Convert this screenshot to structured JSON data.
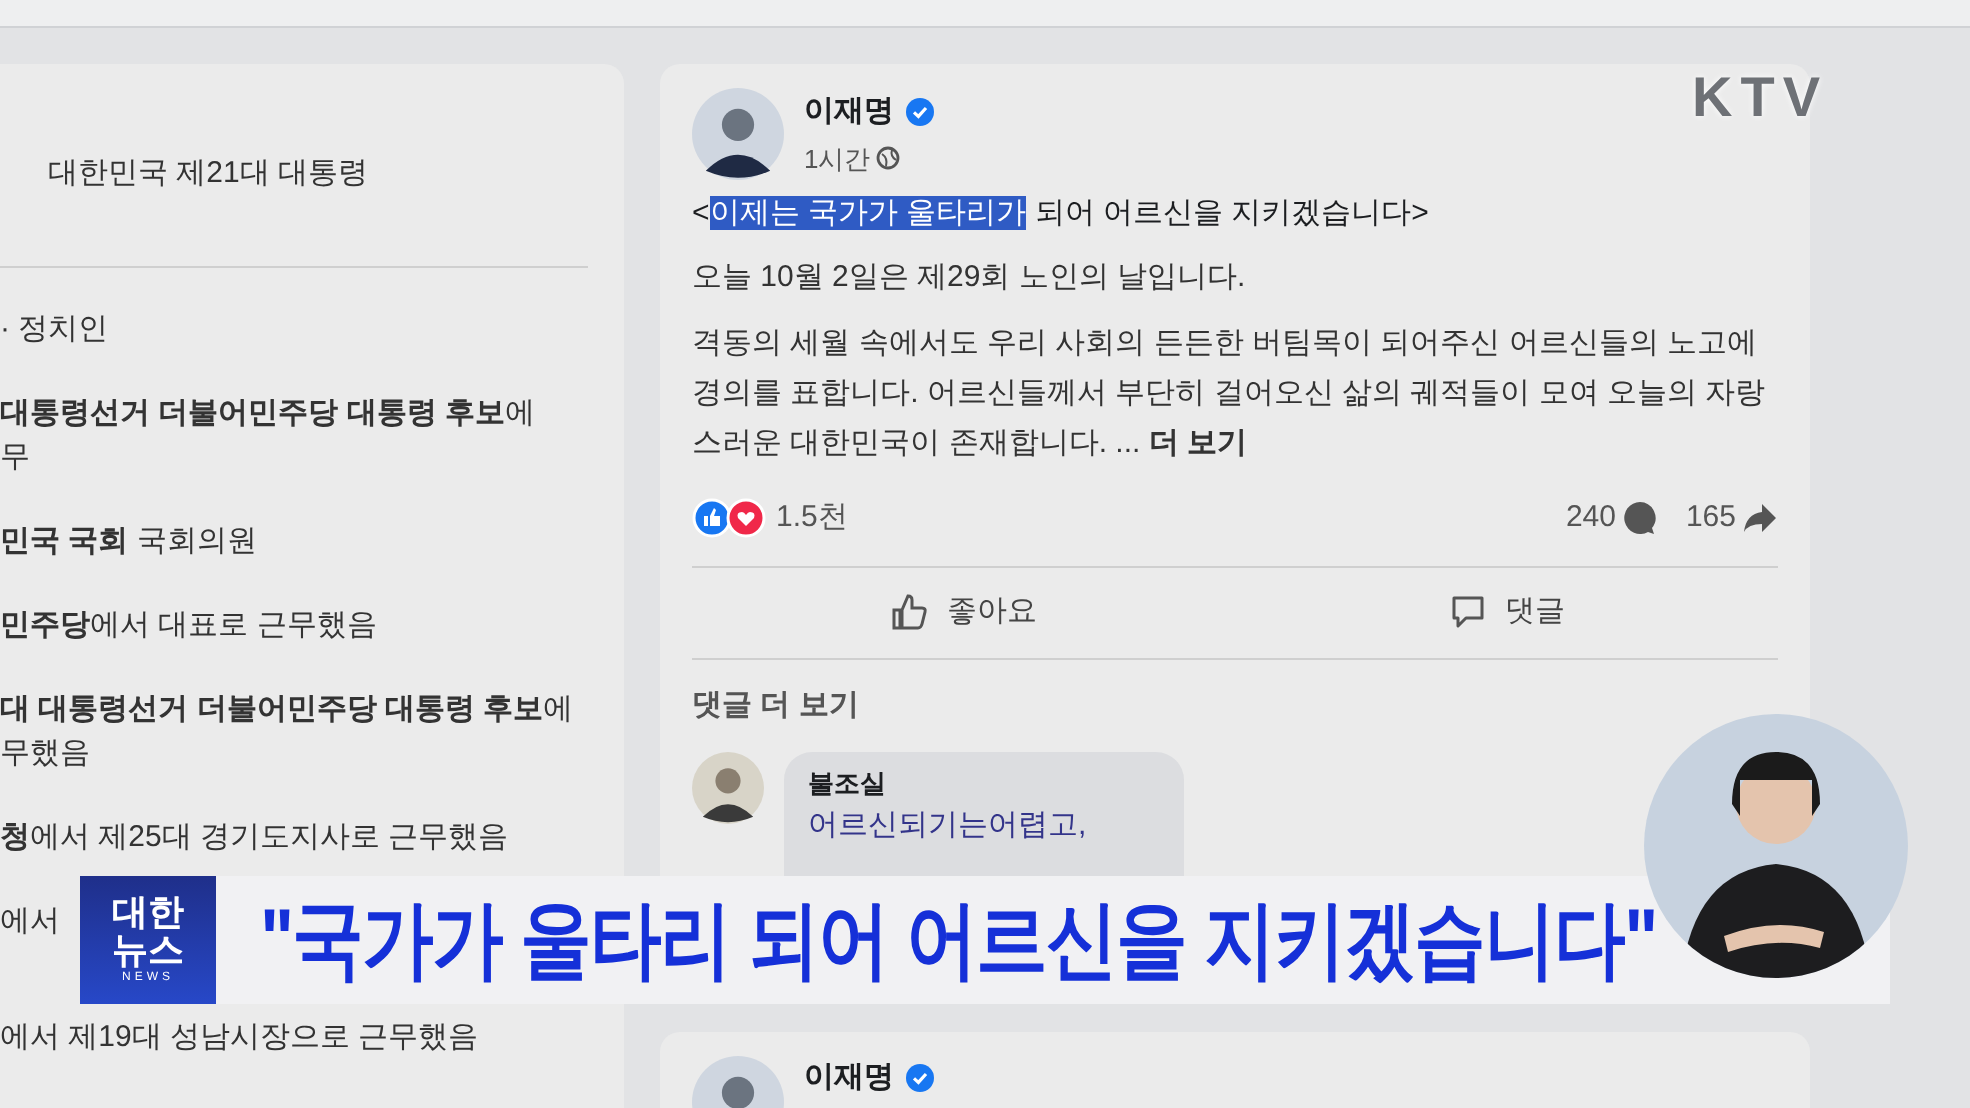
{
  "header": {
    "channel_logo": "KTV"
  },
  "sidebar": {
    "title": "대한민국 제21대 대통령",
    "items": [
      {
        "text": "· 정치인"
      },
      {
        "text": "**대통령선거 더불어민주당 대통령 후보**에",
        "continuation": "무"
      },
      {
        "text": "**민국 국회** 국회의원"
      },
      {
        "text": "**민주당**에서 대표로 근무했음"
      },
      {
        "text": "**대 대통령선거 더불어민주당 대통령 후보**에",
        "continuation": "무했음"
      },
      {
        "text": "**청**에서 제25대 경기도지사로 근무했음"
      },
      {
        "text": "에서"
      },
      {
        "text": "에서 제19대 성남시장으로 근무했음"
      }
    ]
  },
  "post": {
    "author": "이재명",
    "verified": true,
    "time": "1시간",
    "headline": {
      "prefix": "<",
      "highlighted": "이제는 국가가 울타리가",
      "rest": " 되어 어르신을 지키겠습니다>"
    },
    "paragraphs": [
      "오늘 10월 2일은 제29회 노인의 날입니다.",
      "격동의 세월 속에서도 우리 사회의 든든한 버팀목이 되어주신 어르신들의 노고에 경의를 표합니다. 어르신들께서 부단히 걸어오신 삶의 궤적들이 모여 오늘의 자랑스러운 대한민국이 존재합니다. ..."
    ],
    "more": "더 보기",
    "reactions": "1.5천",
    "comments_count": "240",
    "shares_count": "165",
    "actions": [
      {
        "label": "좋아요",
        "kind": "like"
      },
      {
        "label": "댓글",
        "kind": "comment"
      }
    ],
    "more_comments": "댓글 더 보기",
    "comment": {
      "author": "불조실",
      "text": "어르신되기는어렵고,"
    }
  },
  "next_post": {
    "author": "이재명",
    "verified": true
  },
  "caption": {
    "logo_top": "대한",
    "logo_bottom": "뉴스",
    "logo_sub": "NEWS",
    "text": "\"국가가 울타리 되어 어르신을 지키겠습니다\""
  }
}
